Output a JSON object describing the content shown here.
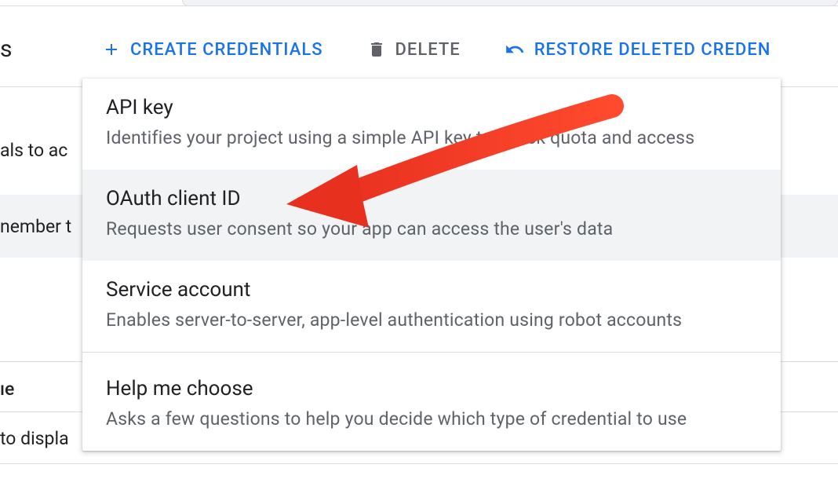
{
  "page_title_fragment": "s",
  "toolbar": {
    "create": "CREATE CREDENTIALS",
    "delete": "DELETE",
    "restore": "RESTORE DELETED CREDEN"
  },
  "dropdown": {
    "items": [
      {
        "title": "API key",
        "desc": "Identifies your project using a simple API key to check quota and access"
      },
      {
        "title": "OAuth client ID",
        "desc": "Requests user consent so your app can access the user's data"
      },
      {
        "title": "Service account",
        "desc": "Enables server-to-server, app-level authentication using robot accounts"
      },
      {
        "title": "Help me choose",
        "desc": "Asks a few questions to help you decide which type of credential to use"
      }
    ]
  },
  "background": {
    "frag1": "als to ac",
    "frag2": "nember t",
    "frag3": "ıe",
    "frag4": "to displa"
  }
}
